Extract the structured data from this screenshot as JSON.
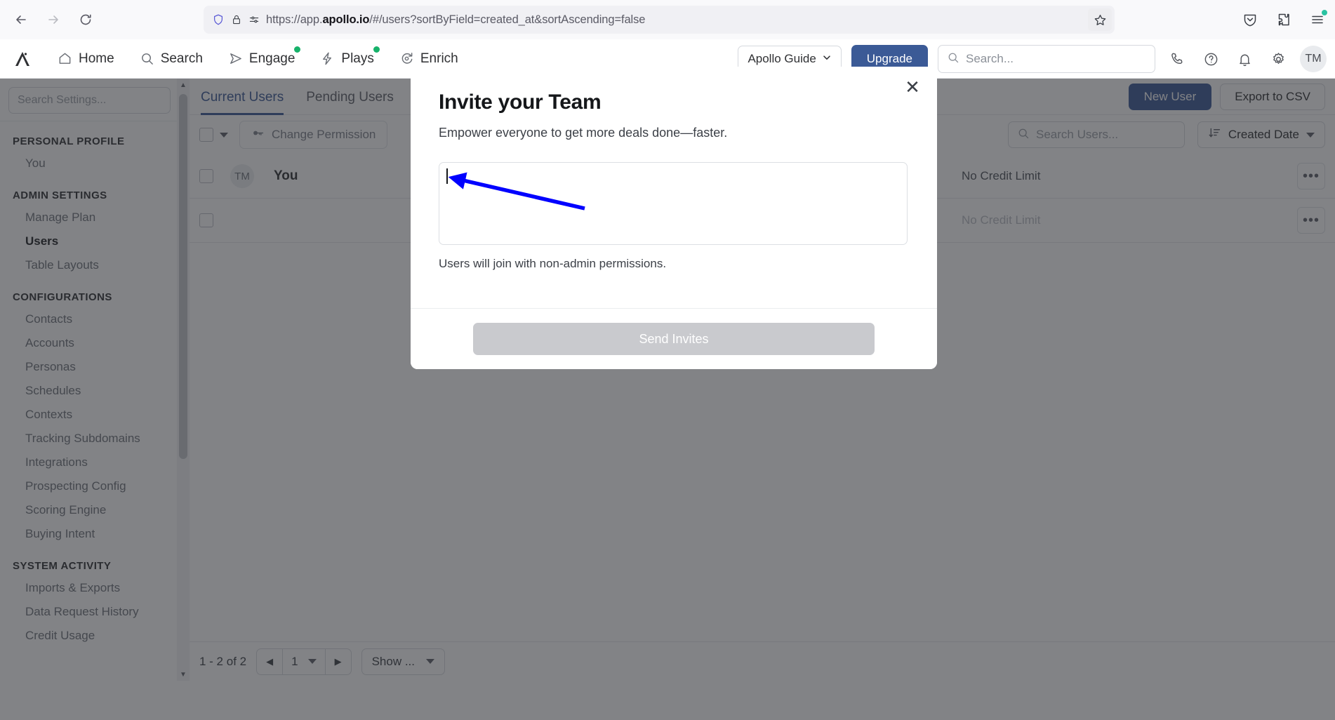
{
  "browser": {
    "back_icon": "back-arrow-icon",
    "forward_icon": "forward-arrow-icon",
    "reload_icon": "reload-icon",
    "url_prefix": "https://app.",
    "url_domain": "apollo.io",
    "url_suffix": "/#/users?sortByField=created_at&sortAscending=false",
    "full_url": "https://app.apollo.io/#/users?sortByField=created_at&sortAscending=false",
    "shield_icon": "shield-icon",
    "lock_icon": "lock-icon",
    "permissions_icon": "site-permissions-icon",
    "bookmark_icon": "star-bookmark-icon",
    "pocket_icon": "pocket-save-icon",
    "extensions_icon": "extensions-puzzle-icon",
    "menu_icon": "hamburger-menu-icon"
  },
  "topnav": {
    "logo": "apollo-logo",
    "items": [
      {
        "label": "Home",
        "icon": "home-icon",
        "dot": false
      },
      {
        "label": "Search",
        "icon": "search-icon",
        "dot": false
      },
      {
        "label": "Engage",
        "icon": "send-icon",
        "dot": true
      },
      {
        "label": "Plays",
        "icon": "lightning-icon",
        "dot": true
      },
      {
        "label": "Enrich",
        "icon": "enrich-icon",
        "dot": false
      }
    ],
    "guide_label": "Apollo Guide",
    "upgrade_label": "Upgrade",
    "search_placeholder": "Search...",
    "icons": [
      {
        "name": "phone-icon"
      },
      {
        "name": "help-circle-icon"
      },
      {
        "name": "bell-icon"
      },
      {
        "name": "gear-icon"
      }
    ],
    "avatar_initials": "TM"
  },
  "sidebar": {
    "search_placeholder": "Search Settings...",
    "groups": [
      {
        "title": "PERSONAL PROFILE",
        "items": [
          {
            "label": "You",
            "active": false
          }
        ]
      },
      {
        "title": "ADMIN SETTINGS",
        "items": [
          {
            "label": "Manage Plan",
            "active": false
          },
          {
            "label": "Users",
            "active": true
          },
          {
            "label": "Table Layouts",
            "active": false
          }
        ]
      },
      {
        "title": "CONFIGURATIONS",
        "items": [
          {
            "label": "Contacts",
            "active": false
          },
          {
            "label": "Accounts",
            "active": false
          },
          {
            "label": "Personas",
            "active": false
          },
          {
            "label": "Schedules",
            "active": false
          },
          {
            "label": "Contexts",
            "active": false
          },
          {
            "label": "Tracking Subdomains",
            "active": false
          },
          {
            "label": "Integrations",
            "active": false
          },
          {
            "label": "Prospecting Config",
            "active": false
          },
          {
            "label": "Scoring Engine",
            "active": false
          },
          {
            "label": "Buying Intent",
            "active": false
          }
        ]
      },
      {
        "title": "SYSTEM ACTIVITY",
        "items": [
          {
            "label": "Imports & Exports",
            "active": false
          },
          {
            "label": "Data Request History",
            "active": false
          },
          {
            "label": "Credit Usage",
            "active": false
          }
        ]
      }
    ]
  },
  "main": {
    "tabs": [
      {
        "label": "Current Users",
        "active": true
      },
      {
        "label": "Pending Users",
        "active": false
      }
    ],
    "new_user_label": "New User",
    "export_label": "Export to CSV",
    "change_permission_label": "Change Permission",
    "permission_icon": "key-icon",
    "search_users_placeholder": "Search Users...",
    "sort_label": "Created Date",
    "sort_icon": "sort-descending-icon",
    "rows": [
      {
        "avatar": "TM",
        "name": "You",
        "credit": "No Credit Limit",
        "faded": false
      },
      {
        "avatar": "",
        "name": "",
        "credit": "No Credit Limit",
        "faded": true
      }
    ],
    "row_menu_icon": "overflow-menu-icon",
    "pagination": {
      "count_label": "1 - 2 of 2",
      "prev_icon": "prev-page-icon",
      "next_icon": "next-page-icon",
      "page_value": "1",
      "show_label": "Show ..."
    }
  },
  "modal": {
    "title": "Invite your Team",
    "subtitle": "Empower everyone to get more deals done—faster.",
    "textarea_value": "",
    "helper_text": "Users will join with non-admin permissions.",
    "send_label": "Send Invites",
    "close_icon": "close-icon"
  },
  "annotation": {
    "arrow_color": "#0000ff",
    "arrow_name": "pointer-arrow-annotation"
  },
  "colors": {
    "brand_blue": "#3b5a96",
    "accent_green": "#17b26a",
    "overlay": "rgba(40,42,46,0.58)",
    "disabled_button": "#c9cace"
  }
}
